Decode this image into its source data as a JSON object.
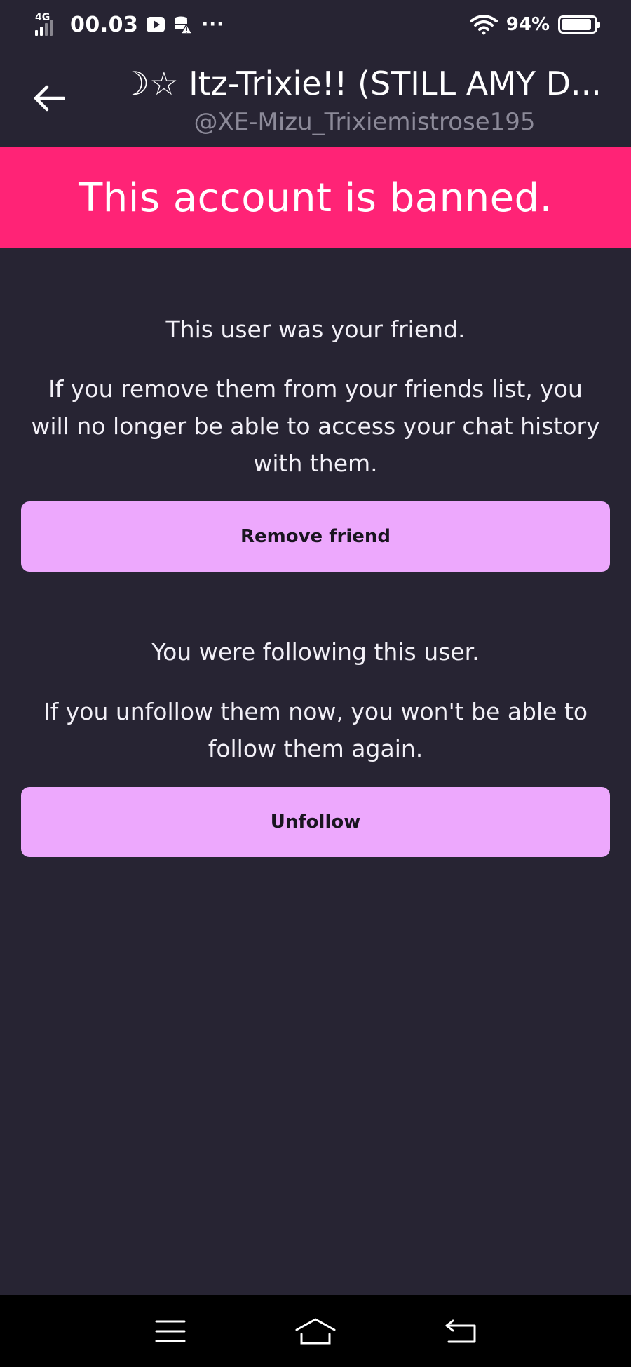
{
  "status_bar": {
    "network": "4G",
    "time": "00.03",
    "more": "···",
    "battery_percent": "94%"
  },
  "header": {
    "title": "☽☆ Itz-Trixie!! (STILL AMY D...",
    "handle": "@XE-Mizu_Trixiemistrose195"
  },
  "banner": {
    "text": "This account is banned.",
    "color": "#ff2376"
  },
  "friend_section": {
    "heading": "This user was your friend.",
    "body": "If you remove them from your friends list, you will no longer be able to access your chat history with them.",
    "button_label": "Remove friend"
  },
  "follow_section": {
    "heading": "You were following this user.",
    "body": "If you unfollow them now, you won't be able to follow them again.",
    "button_label": "Unfollow"
  },
  "colors": {
    "background": "#272433",
    "button": "#eda8fd",
    "muted_text": "#8c8a99"
  },
  "nav_bar": {
    "icons": [
      "menu-icon",
      "home-icon",
      "back-nav-icon"
    ]
  }
}
